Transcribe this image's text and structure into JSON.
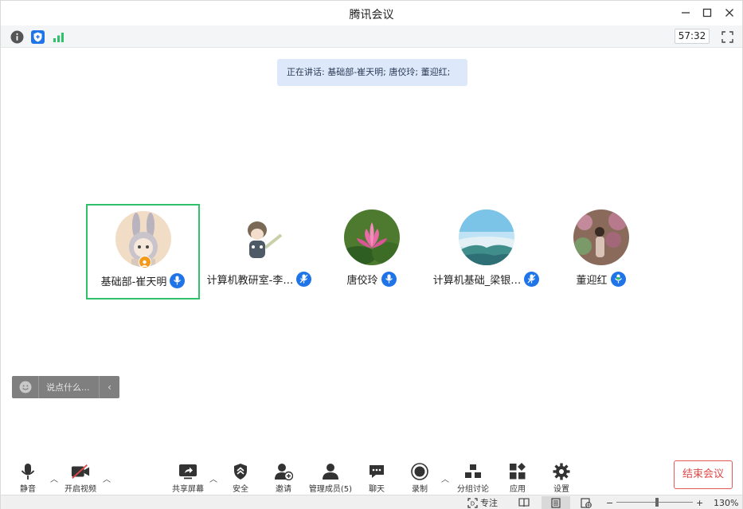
{
  "window": {
    "title": "腾讯会议"
  },
  "infobar": {
    "timer": "57:32"
  },
  "speaking": {
    "text": "正在讲话: 基础部-崔天明; 唐佼玲; 董迎红;"
  },
  "participants": [
    {
      "name": "基础部-崔天明",
      "active": true,
      "host": true
    },
    {
      "name": "计算机教研室-李…",
      "active": false,
      "host": false
    },
    {
      "name": "唐佼玲",
      "active": false,
      "host": false
    },
    {
      "name": "计算机基础_梁银…",
      "active": false,
      "host": false
    },
    {
      "name": "董迎红",
      "active": false,
      "host": false
    }
  ],
  "chat": {
    "placeholder": "说点什么..."
  },
  "toolbar": {
    "mute": "静音",
    "video": "开启视频",
    "share": "共享屏幕",
    "security": "安全",
    "invite": "邀请",
    "members": "管理成员(5)",
    "chat": "聊天",
    "record": "录制",
    "breakout": "分组讨论",
    "apps": "应用",
    "settings": "设置",
    "end": "结束会议"
  },
  "statusbar": {
    "focus": "专注",
    "zoom": "130%"
  },
  "colors": {
    "accent": "#1f74e8",
    "active_border": "#2fc26a",
    "end": "#e04848",
    "speaking_bg": "#dde9fb"
  }
}
